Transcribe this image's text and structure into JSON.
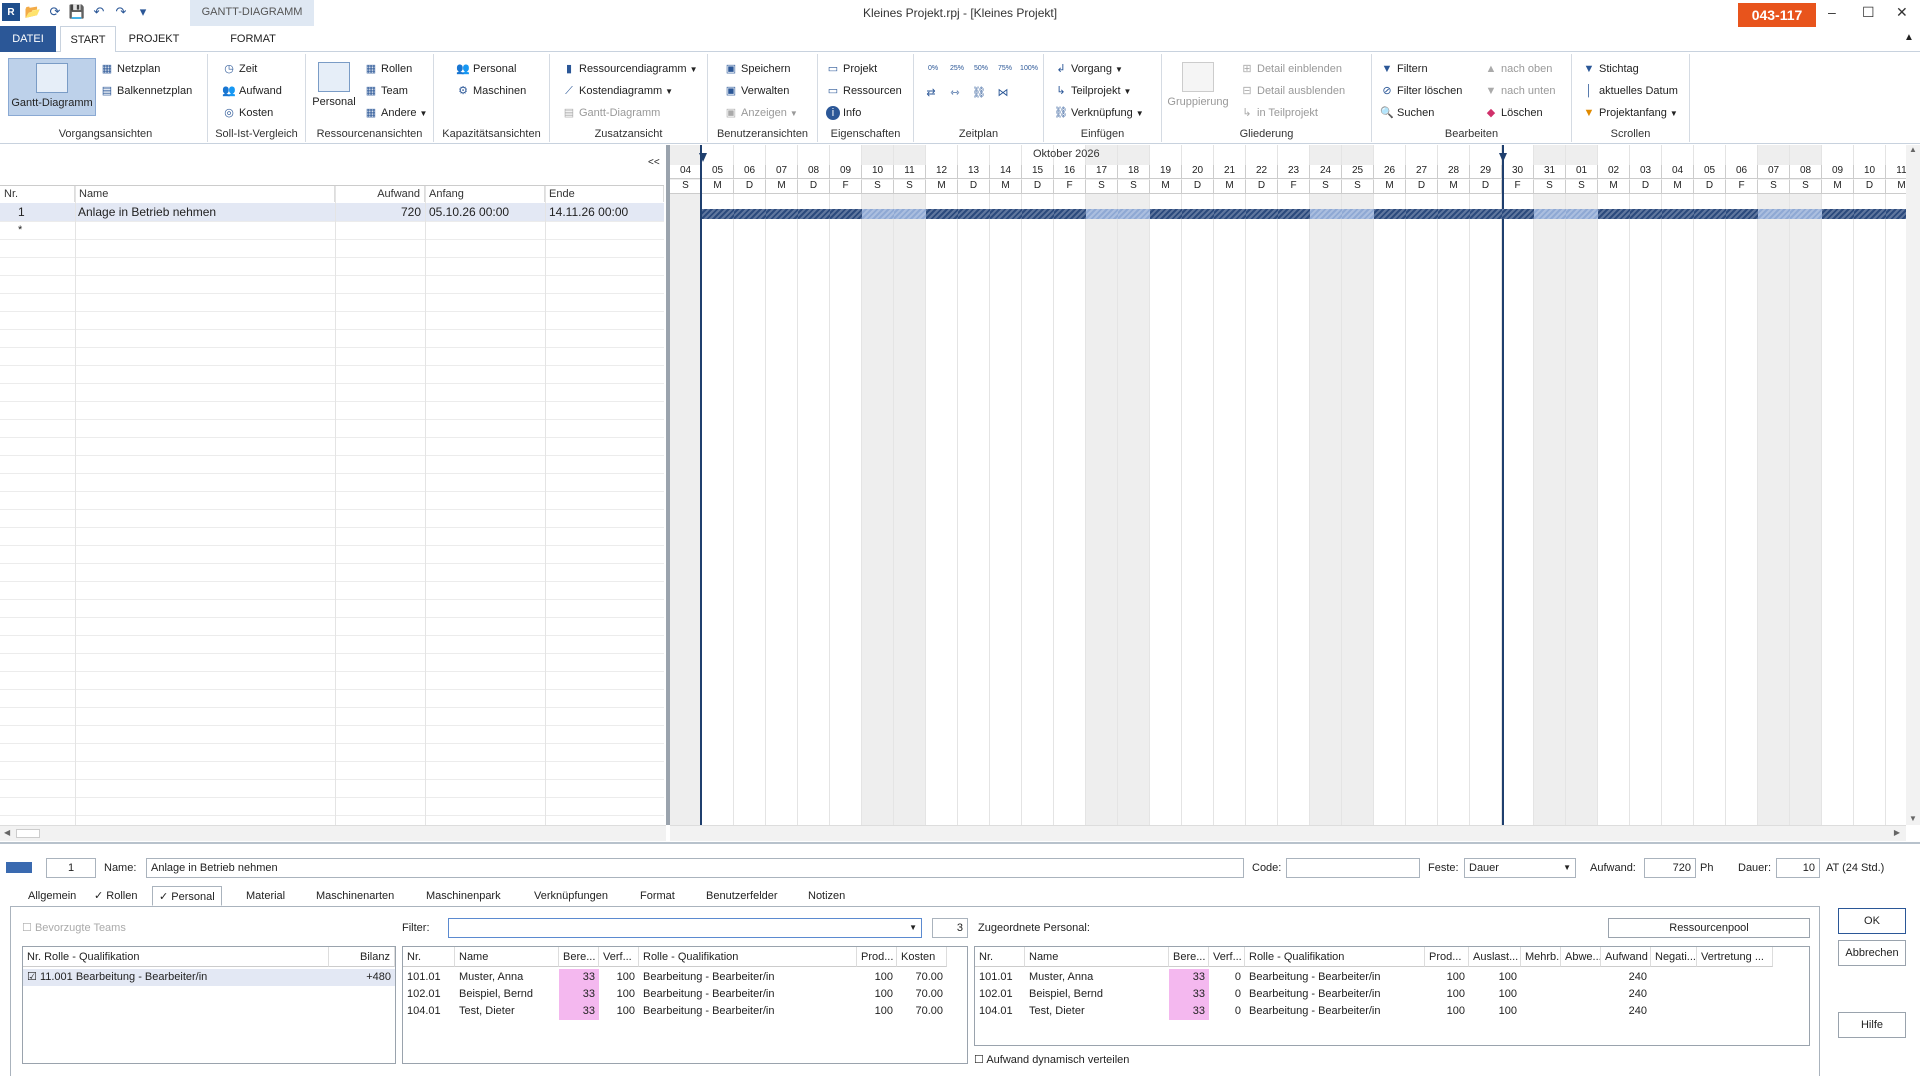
{
  "window": {
    "title": "Kleines Projekt.rpj - [Kleines Projekt]",
    "badge": "043-117",
    "context_tab": "GANTT-DIAGRAMM"
  },
  "tabs": [
    "DATEI",
    "START",
    "PROJEKT",
    "FORMAT"
  ],
  "ribbon": {
    "vorgangsansichten": {
      "label": "Vorgangsansichten",
      "big": "Gantt-Diagramm",
      "items": [
        "Netzplan",
        "Balkennetzplan"
      ]
    },
    "sollist": {
      "label": "Soll-Ist-Vergleich",
      "items": [
        "Zeit",
        "Aufwand",
        "Kosten"
      ]
    },
    "ressourcen": {
      "label": "Ressourcenansichten",
      "big": "Personal",
      "items": [
        "Rollen",
        "Team",
        "Andere"
      ]
    },
    "kapazitaet": {
      "label": "Kapazitätsansichten",
      "items": [
        "Personal",
        "Maschinen"
      ]
    },
    "zusatz": {
      "label": "Zusatzansicht",
      "items": [
        "Ressourcendiagramm",
        "Kostendiagramm",
        "Gantt-Diagramm"
      ]
    },
    "benutzer": {
      "label": "Benutzeransichten",
      "items": [
        "Speichern",
        "Verwalten",
        "Anzeigen"
      ]
    },
    "eigenschaften": {
      "label": "Eigenschaften",
      "items": [
        "Projekt",
        "Ressourcen",
        "Info"
      ]
    },
    "zeitplan": {
      "label": "Zeitplan",
      "pct": [
        "0%",
        "25%",
        "50%",
        "75%",
        "100%"
      ]
    },
    "einfuegen": {
      "label": "Einfügen",
      "items": [
        "Vorgang",
        "Teilprojekt",
        "Verknüpfung"
      ]
    },
    "gliederung": {
      "label": "Gliederung",
      "big": "Gruppierung",
      "items": [
        "Detail einblenden",
        "Detail ausblenden",
        "in Teilprojekt"
      ]
    },
    "bearbeiten": {
      "label": "Bearbeiten",
      "items": [
        "Filtern",
        "Filter löschen",
        "Suchen",
        "nach oben",
        "nach unten",
        "Löschen"
      ]
    },
    "scrollen": {
      "label": "Scrollen",
      "items": [
        "Stichtag",
        "aktuelles Datum",
        "Projektanfang"
      ]
    }
  },
  "table": {
    "headers": [
      "Nr.",
      "Name",
      "Aufwand",
      "Anfang",
      "Ende"
    ],
    "rows": [
      {
        "nr": "1",
        "name": "Anlage in Betrieb nehmen",
        "aufwand": "720",
        "anfang": "05.10.26 00:00",
        "ende": "14.11.26 00:00"
      }
    ],
    "new_row_marker": "*",
    "collapse": "<<"
  },
  "gantt": {
    "month": "Oktober 2026",
    "days": [
      "04",
      "05",
      "06",
      "07",
      "08",
      "09",
      "10",
      "11",
      "12",
      "13",
      "14",
      "15",
      "16",
      "17",
      "18",
      "19",
      "20",
      "21",
      "22",
      "23",
      "24",
      "25",
      "26",
      "27",
      "28",
      "29",
      "30",
      "31",
      "01",
      "02",
      "03",
      "04",
      "05",
      "06",
      "07",
      "08",
      "09",
      "10",
      "11"
    ],
    "dow": [
      "S",
      "M",
      "D",
      "M",
      "D",
      "F",
      "S",
      "S",
      "M",
      "D",
      "M",
      "D",
      "F",
      "S",
      "S",
      "M",
      "D",
      "M",
      "D",
      "F",
      "S",
      "S",
      "M",
      "D",
      "M",
      "D",
      "F",
      "S",
      "S",
      "M",
      "D",
      "M",
      "D",
      "F",
      "S",
      "S",
      "M",
      "D",
      "M"
    ],
    "weekend_index": [
      0,
      6,
      7,
      13,
      14,
      20,
      21,
      27,
      28,
      34,
      35
    ],
    "bar_start_day": 1,
    "today_day": 25
  },
  "detail": {
    "nr": "1",
    "name_label": "Name:",
    "name": "Anlage in Betrieb nehmen",
    "code_label": "Code:",
    "code": "",
    "feste_label": "Feste:",
    "feste": "Dauer",
    "aufwand_label": "Aufwand:",
    "aufwand": "720",
    "aufwand_unit": "Ph",
    "dauer_label": "Dauer:",
    "dauer": "10",
    "dauer_unit": "AT (24 Std.)",
    "tabs": [
      "Allgemein",
      "Rollen",
      "Personal",
      "Material",
      "Maschinenarten",
      "Maschinenpark",
      "Verknüpfungen",
      "Format",
      "Benutzerfelder",
      "Notizen"
    ],
    "teams_label": "Bevorzugte Teams",
    "filter_label": "Filter:",
    "filter_count": "3",
    "assigned_label": "Zugeordnete Personal:",
    "pool_button": "Ressourcenpool",
    "roles": {
      "headers": [
        "Nr. Rolle - Qualifikation",
        "Bilanz"
      ],
      "rows": [
        {
          "role": "11.001 Bearbeitung - Bearbeiter/in",
          "bilanz": "+480"
        }
      ]
    },
    "avail": {
      "headers": [
        "Nr.",
        "Name",
        "Bere...",
        "Verf...",
        "Rolle - Qualifikation",
        "Prod...",
        "Kosten"
      ],
      "rows": [
        [
          "101.01",
          "Muster, Anna",
          "33",
          "100",
          "Bearbeitung - Bearbeiter/in",
          "100",
          "70.00"
        ],
        [
          "102.01",
          "Beispiel, Bernd",
          "33",
          "100",
          "Bearbeitung - Bearbeiter/in",
          "100",
          "70.00"
        ],
        [
          "104.01",
          "Test, Dieter",
          "33",
          "100",
          "Bearbeitung - Bearbeiter/in",
          "100",
          "70.00"
        ]
      ]
    },
    "assigned": {
      "headers": [
        "Nr.",
        "Name",
        "Bere...",
        "Verf...",
        "Rolle - Qualifikation",
        "Prod...",
        "Auslast...",
        "Mehrb...",
        "Abwe...",
        "Aufwand",
        "Negati...",
        "Vertretung ..."
      ],
      "rows": [
        [
          "101.01",
          "Muster, Anna",
          "33",
          "0",
          "Bearbeitung - Bearbeiter/in",
          "100",
          "100",
          "",
          "",
          "240",
          "",
          ""
        ],
        [
          "102.01",
          "Beispiel, Bernd",
          "33",
          "0",
          "Bearbeitung - Bearbeiter/in",
          "100",
          "100",
          "",
          "",
          "240",
          "",
          ""
        ],
        [
          "104.01",
          "Test, Dieter",
          "33",
          "0",
          "Bearbeitung - Bearbeiter/in",
          "100",
          "100",
          "",
          "",
          "240",
          "",
          ""
        ]
      ]
    },
    "dynamic_label": "Aufwand dynamisch verteilen",
    "buttons": {
      "ok": "OK",
      "cancel": "Abbrechen",
      "help": "Hilfe"
    }
  },
  "colors": {
    "accent": "#2b5797",
    "badge": "#e8541c",
    "bar_dark": "#2b4a7d",
    "bar_light": "#8fa9d4",
    "pink": "#f4b8ef"
  }
}
